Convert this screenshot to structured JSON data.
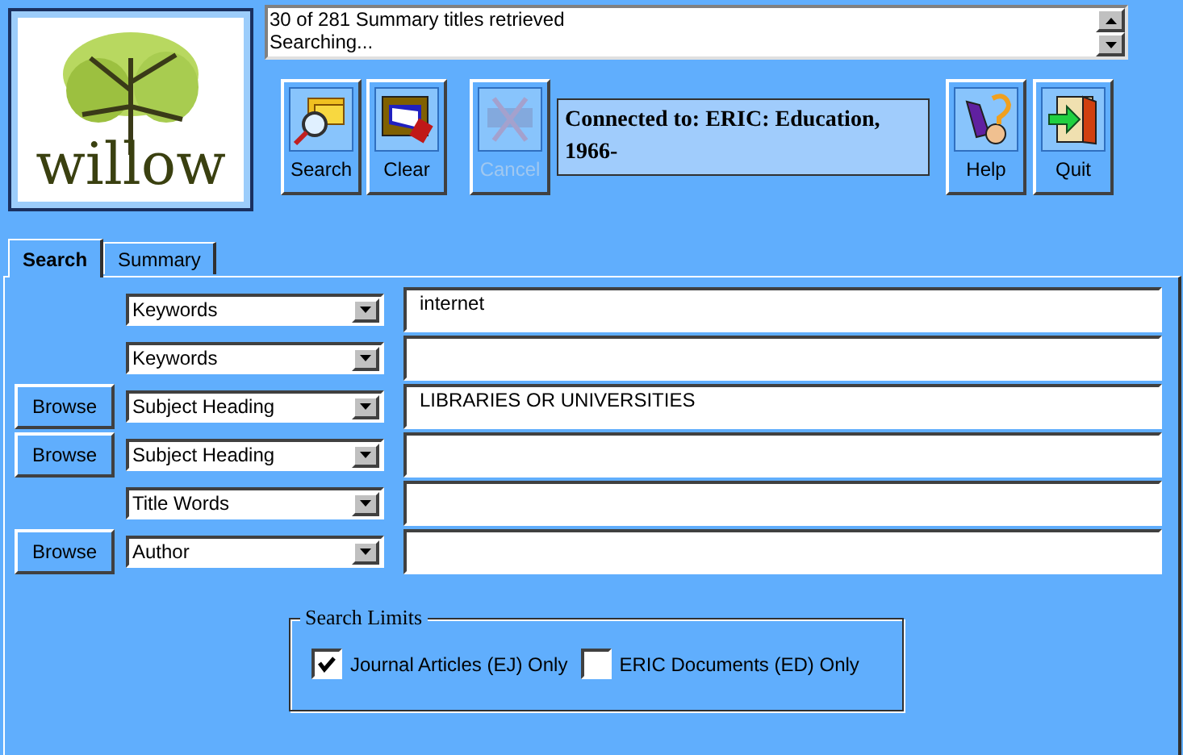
{
  "logo": {
    "text": "willow"
  },
  "status": {
    "lines": [
      "30 of 281 Summary titles retrieved",
      "Searching..."
    ]
  },
  "toolbar": [
    {
      "kind": "search",
      "label": "Search",
      "disabled": false
    },
    {
      "kind": "clear",
      "label": "Clear",
      "disabled": false
    },
    {
      "kind": "cancel",
      "label": "Cancel",
      "disabled": true
    }
  ],
  "connection": "Connected to: ERIC: Education, 1966-",
  "toolbar_right": [
    {
      "kind": "help",
      "label": "Help",
      "disabled": false
    },
    {
      "kind": "quit",
      "label": "Quit",
      "disabled": false
    }
  ],
  "tabs": [
    {
      "label": "Search",
      "selected": true
    },
    {
      "label": "Summary",
      "selected": false
    }
  ],
  "rows": [
    {
      "browse": null,
      "field": "Keywords",
      "value": "internet"
    },
    {
      "browse": null,
      "field": "Keywords",
      "value": ""
    },
    {
      "browse": "Browse",
      "field": "Subject Heading",
      "value": "LIBRARIES OR UNIVERSITIES"
    },
    {
      "browse": "Browse",
      "field": "Subject Heading",
      "value": ""
    },
    {
      "browse": null,
      "field": "Title Words",
      "value": ""
    },
    {
      "browse": "Browse",
      "field": "Author",
      "value": ""
    }
  ],
  "search_limits": {
    "title": "Search Limits",
    "options": [
      {
        "label": "Journal Articles (EJ) Only",
        "checked": true
      },
      {
        "label": "ERIC Documents (ED) Only",
        "checked": false
      }
    ]
  }
}
